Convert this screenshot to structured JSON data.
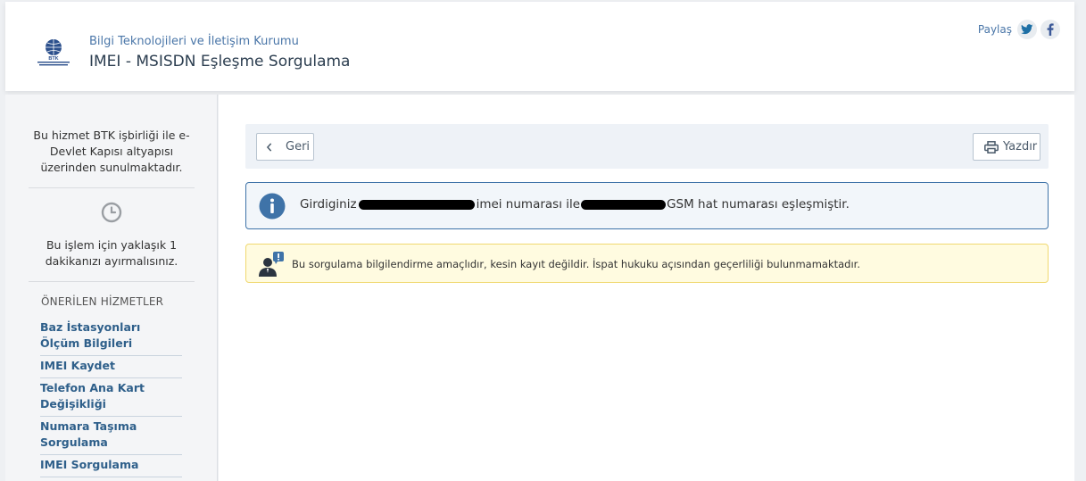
{
  "header": {
    "org_name": "Bilgi Teknolojileri ve İletişim Kurumu",
    "service_title": "IMEI - MSISDN Eşleşme Sorgulama",
    "logo_text": "BTK",
    "share_label": "Paylaş"
  },
  "sidebar": {
    "partner_note": "Bu hizmet BTK işbirliği ile e-Devlet Kapısı altyapısı üzerinden sunulmaktadır.",
    "time_note": "Bu işlem için yaklaşık 1 dakikanızı ayırmalısınız.",
    "recommended_title": "ÖNERİLEN HİZMETLER",
    "recommended": [
      {
        "label": "Baz İstasyonları Ölçüm Bilgileri"
      },
      {
        "label": "IMEI Kaydet"
      },
      {
        "label": "Telefon Ana Kart Değişikliği"
      },
      {
        "label": "Numara Taşıma Sorgulama"
      },
      {
        "label": "IMEI Sorgulama"
      }
    ]
  },
  "toolbar": {
    "back_label": "Geri",
    "print_label": "Yazdır"
  },
  "result": {
    "prefix": "Girdiginiz",
    "middle": "imei numarası ile",
    "suffix": "GSM hat numarası eşleşmiştir."
  },
  "warning": {
    "text": "Bu sorgulama bilgilendirme amaçlıdır, kesin kayıt değildir. İspat hukuku açısından geçerliliği bulunmamaktadır."
  },
  "colors": {
    "accent": "#3f73a8",
    "link": "#2e5f8a",
    "warning_bg": "#fffbe0",
    "warning_border": "#f0d870",
    "twitter": "#1d6fa5",
    "facebook": "#3b5998"
  }
}
